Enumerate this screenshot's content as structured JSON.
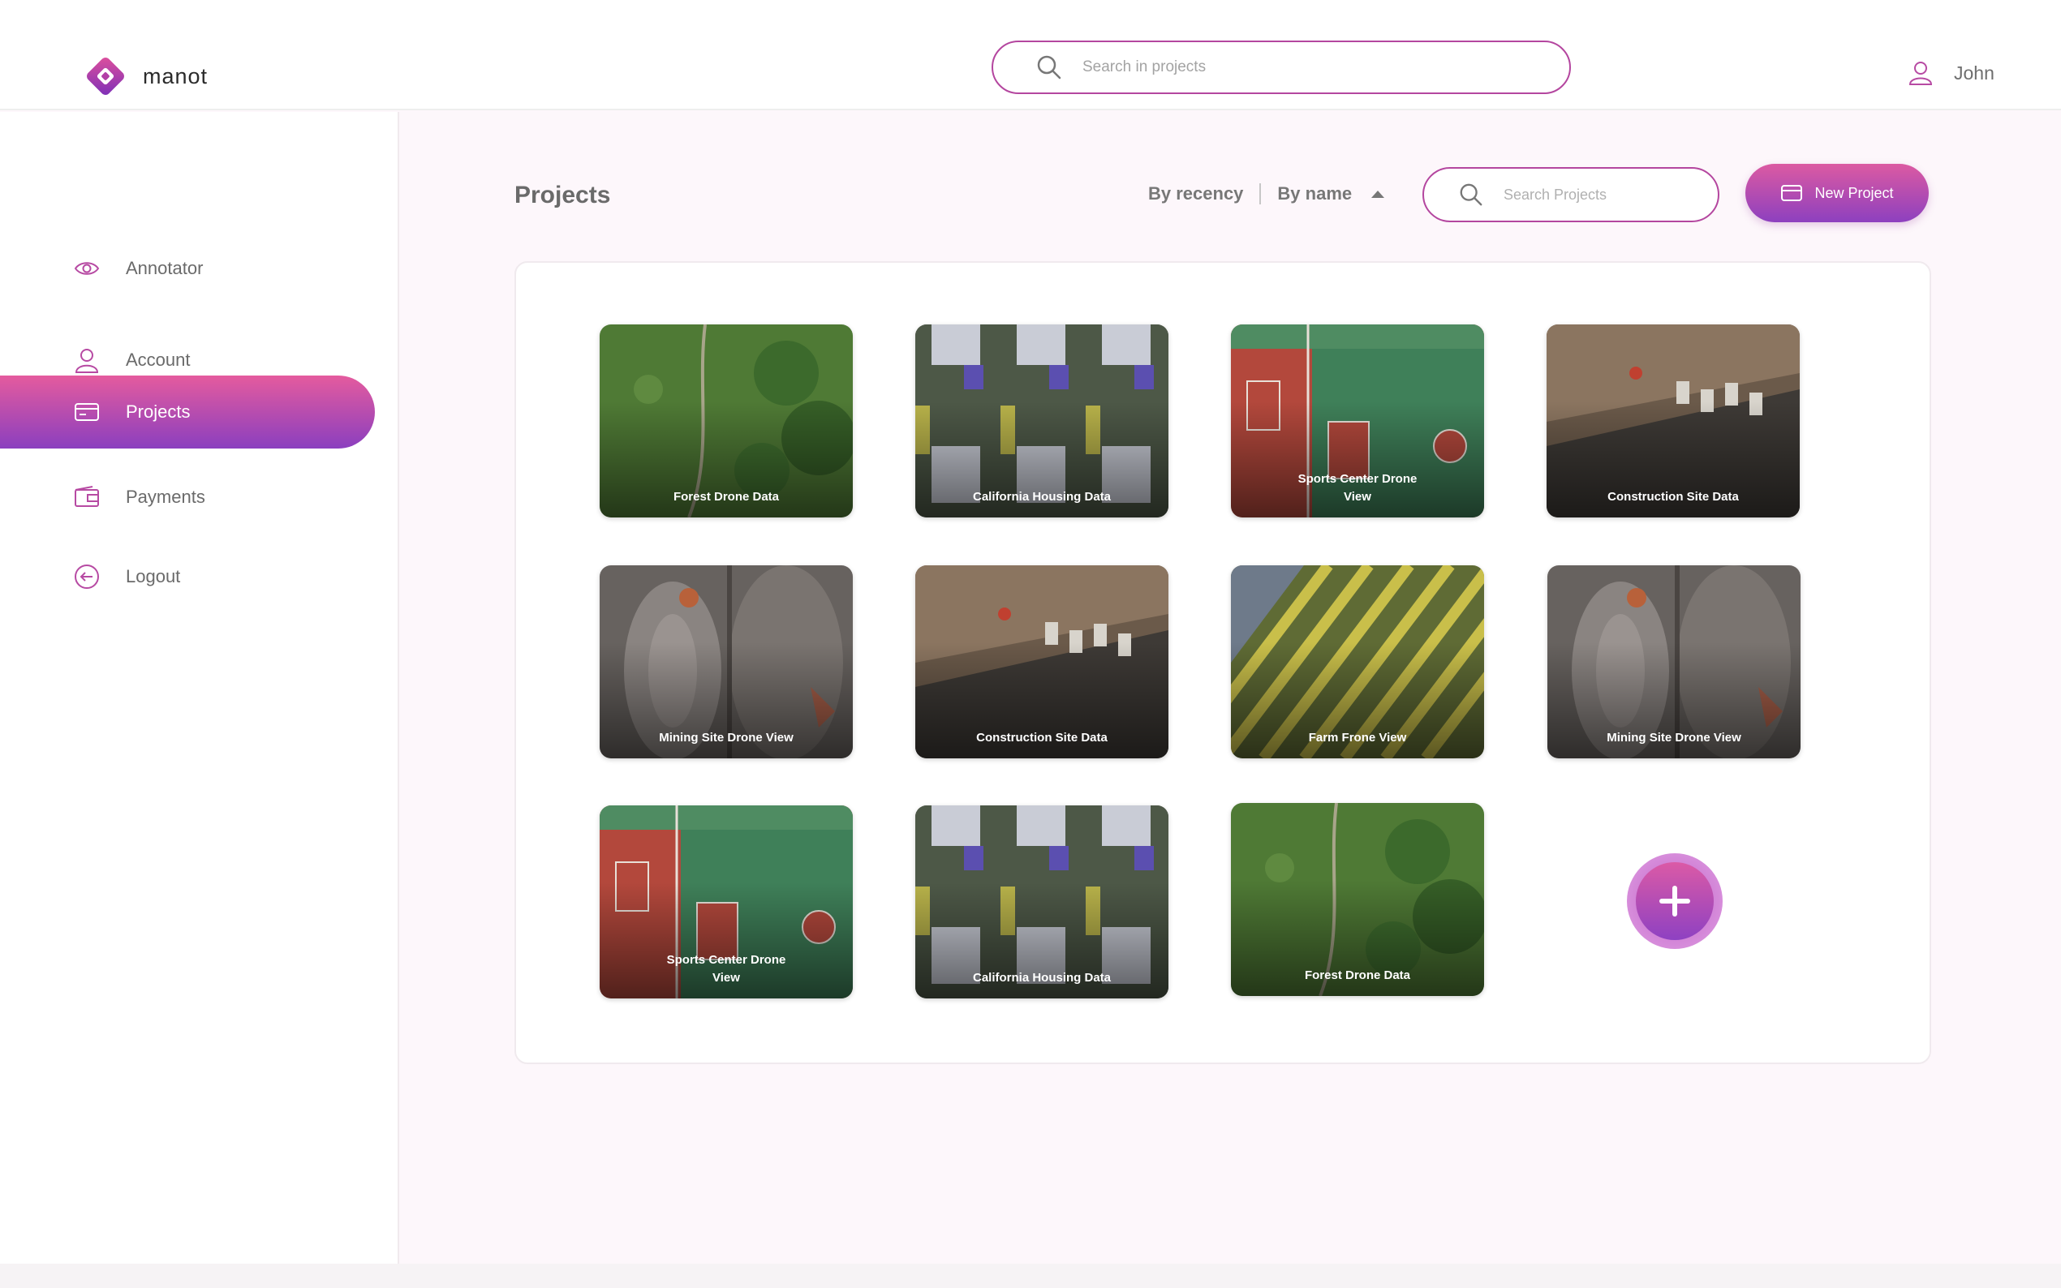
{
  "app": {
    "name": "manot"
  },
  "header": {
    "search_placeholder": "Search in projects",
    "user_name": "John"
  },
  "sidebar": {
    "items": [
      {
        "label": "Annotator",
        "icon": "eye-icon",
        "active": false
      },
      {
        "label": "Account",
        "icon": "user-icon",
        "active": false
      },
      {
        "label": "Projects",
        "icon": "card-icon",
        "active": true
      },
      {
        "label": "Payments",
        "icon": "wallet-icon",
        "active": false
      },
      {
        "label": "Logout",
        "icon": "logout-icon",
        "active": false
      }
    ]
  },
  "main": {
    "title": "Projects",
    "sort": {
      "recency_label": "By recency",
      "name_label": "By name",
      "direction": "ascending"
    },
    "search_placeholder": "Search Projects",
    "new_project_label": "New Project",
    "projects": [
      {
        "title": "Forest Drone Data",
        "thumb": "forest"
      },
      {
        "title": "California Housing Data",
        "thumb": "housing"
      },
      {
        "title": "Sports Center Drone View",
        "thumb": "sports"
      },
      {
        "title": "Construction Site Data",
        "thumb": "construction"
      },
      {
        "title": "Mining Site Drone View",
        "thumb": "mining"
      },
      {
        "title": "Construction Site Data",
        "thumb": "construction"
      },
      {
        "title": "Farm Frone View",
        "thumb": "farm"
      },
      {
        "title": "Mining Site Drone View",
        "thumb": "mining"
      },
      {
        "title": "Sports Center Drone View",
        "thumb": "sports"
      },
      {
        "title": "California Housing Data",
        "thumb": "housing"
      },
      {
        "title": "Forest Drone Data",
        "thumb": "forest"
      }
    ]
  },
  "colors": {
    "accent_start": "#e55b9e",
    "accent_end": "#8b3fbf",
    "border": "#b4469f"
  }
}
